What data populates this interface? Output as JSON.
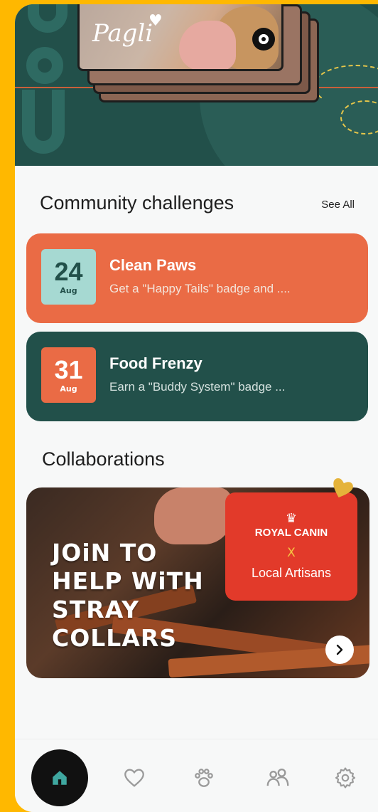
{
  "hero": {
    "pet_name": "Pagli"
  },
  "community": {
    "title": "Community challenges",
    "see_all": "See All",
    "challenges": [
      {
        "day": "24",
        "month": "Aug",
        "title": "Clean Paws",
        "description": "Get a \"Happy Tails\" badge and ...."
      },
      {
        "day": "31",
        "month": "Aug",
        "title": "Food Frenzy",
        "description": "Earn a \"Buddy System\" badge ..."
      }
    ]
  },
  "collaborations": {
    "title": "Collaborations",
    "banner": {
      "headline_lines": [
        "JOiN TO",
        "HELP WiTH",
        "STRAY",
        "COLLARS"
      ],
      "brand": "ROYAL CANIN",
      "x": "X",
      "partner": "Local Artisans"
    }
  },
  "nav": {
    "items": [
      {
        "icon": "home-icon",
        "active": true
      },
      {
        "icon": "heart-icon",
        "active": false
      },
      {
        "icon": "paw-icon",
        "active": false
      },
      {
        "icon": "community-icon",
        "active": false
      },
      {
        "icon": "settings-icon",
        "active": false
      }
    ]
  },
  "colors": {
    "page_bg": "#FFB800",
    "dark_green": "#22504A",
    "orange": "#EA6B45",
    "brand_red": "#E23A2A"
  }
}
